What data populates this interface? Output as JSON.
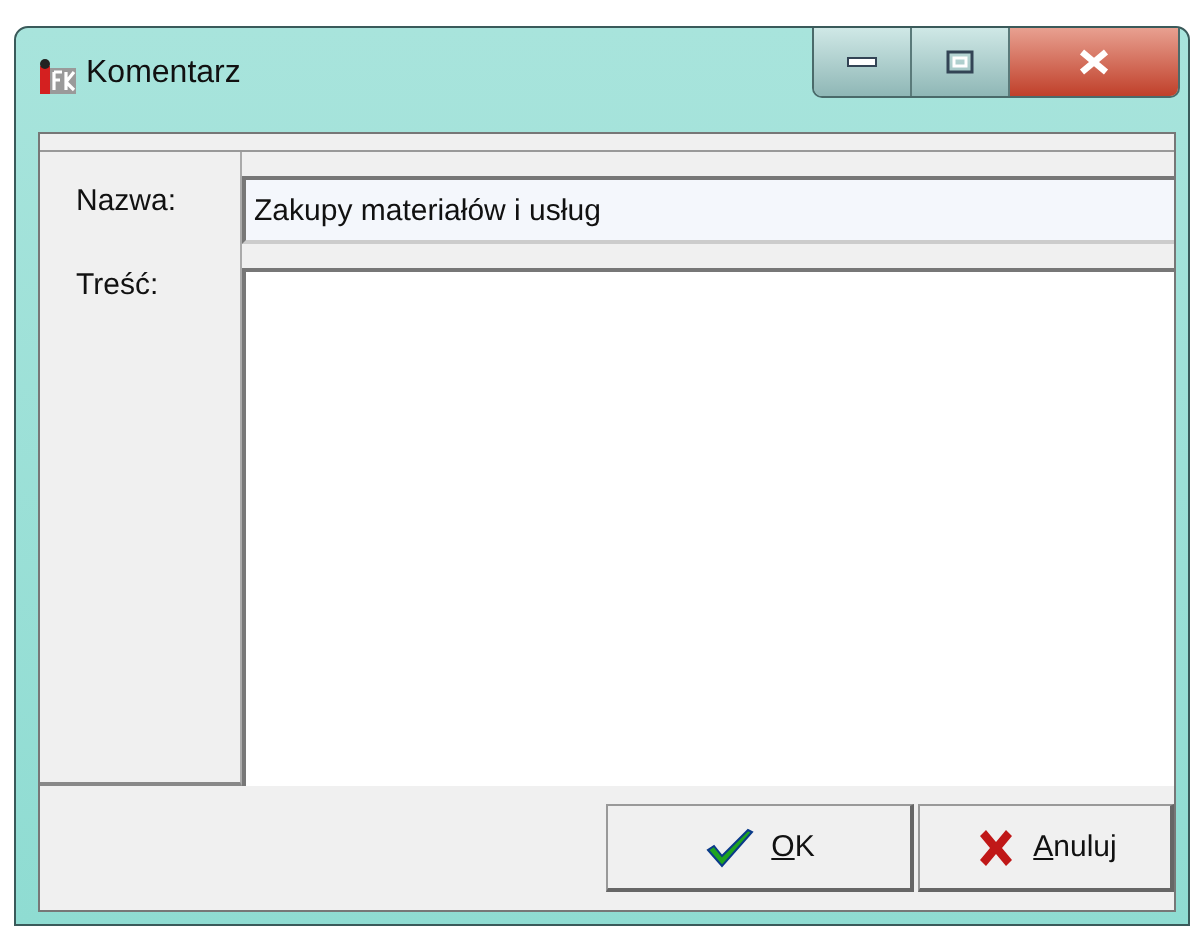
{
  "window": {
    "title": "Komentarz"
  },
  "form": {
    "name_label": "Nazwa:",
    "name_value": "Zakupy materiałów i usług",
    "content_label": "Treść:"
  },
  "buttons": [
    {
      "kind": "ok",
      "label": "OK"
    },
    {
      "kind": "cancel",
      "label": "Anuluj"
    }
  ]
}
